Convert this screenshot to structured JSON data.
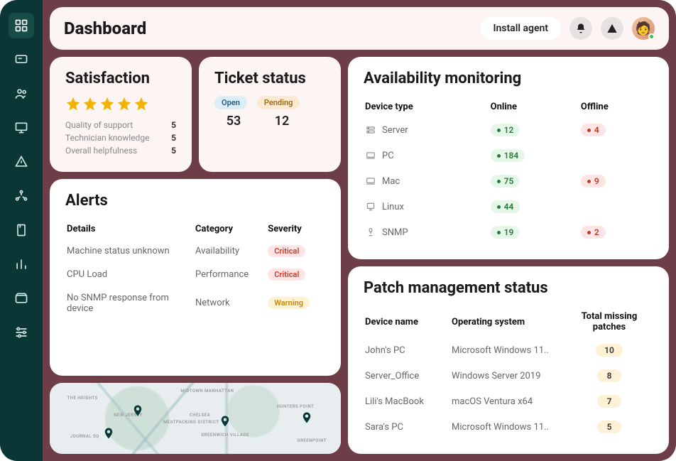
{
  "header": {
    "title": "Dashboard",
    "install_label": "Install agent"
  },
  "sidebar": {
    "items": [
      "dashboard",
      "messages",
      "users",
      "devices",
      "alerts",
      "integrations",
      "docs",
      "reports",
      "billing",
      "settings"
    ]
  },
  "satisfaction": {
    "title": "Satisfaction",
    "stars": 5,
    "metrics": [
      {
        "label": "Quality of support",
        "value": "5"
      },
      {
        "label": "Technician knowledge",
        "value": "5"
      },
      {
        "label": "Overall helpfulness",
        "value": "5"
      }
    ]
  },
  "tickets": {
    "title": "Ticket status",
    "open_label": "Open",
    "pending_label": "Pending",
    "open_count": "53",
    "pending_count": "12"
  },
  "availability": {
    "title": "Availability monitoring",
    "cols": {
      "type": "Device type",
      "online": "Online",
      "offline": "Offline"
    },
    "rows": [
      {
        "icon": "server",
        "type": "Server",
        "online": "12",
        "offline": "4"
      },
      {
        "icon": "pc",
        "type": "PC",
        "online": "184",
        "offline": ""
      },
      {
        "icon": "mac",
        "type": "Mac",
        "online": "75",
        "offline": "9"
      },
      {
        "icon": "linux",
        "type": "Linux",
        "online": "44",
        "offline": ""
      },
      {
        "icon": "snmp",
        "type": "SNMP",
        "online": "19",
        "offline": "2"
      }
    ]
  },
  "alerts": {
    "title": "Alerts",
    "cols": {
      "details": "Details",
      "category": "Category",
      "severity": "Severity"
    },
    "rows": [
      {
        "details": "Machine status unknown",
        "category": "Availability",
        "severity": "Critical",
        "sev_class": "crit"
      },
      {
        "details": "CPU Load",
        "category": "Performance",
        "severity": "Critical",
        "sev_class": "crit"
      },
      {
        "details": "No SNMP response from device",
        "category": "Network",
        "severity": "Warning",
        "sev_class": "warn"
      }
    ]
  },
  "patch": {
    "title": "Patch management status",
    "cols": {
      "name": "Device name",
      "os": "Operating system",
      "total": "Total missing patches"
    },
    "rows": [
      {
        "name": "John's PC",
        "os": "Microsoft Windows 11..",
        "count": "10"
      },
      {
        "name": "Server_Office",
        "os": "Windows Server 2019",
        "count": "8"
      },
      {
        "name": "Lili's MacBook",
        "os": "macOS Ventura x64",
        "count": "7"
      },
      {
        "name": "Sara's PC",
        "os": "Microsoft Windows 11..",
        "count": "5"
      }
    ]
  },
  "map": {
    "labels": [
      "THE HEIGHTS",
      "NEW JERSEY",
      "CHELSEA",
      "MEATPACKING DISTRICT",
      "GREENWICH VILLAGE",
      "MIDTOWN MANHATTAN",
      "HUNTERS POINT",
      "GREENPOINT",
      "JOURNAL SQ"
    ]
  }
}
